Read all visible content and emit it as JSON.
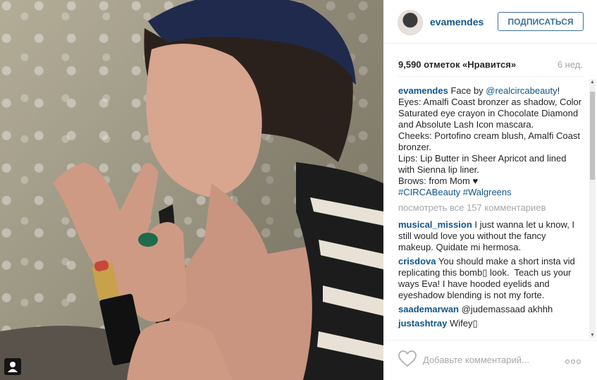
{
  "post": {
    "username": "evamendes",
    "follow_label": "ПОДПИСАТЬСЯ",
    "likes": "9,590 отметок «Нравится»",
    "age": "6 нед."
  },
  "caption": {
    "user": "evamendes",
    "lead": " Face by ",
    "mention": "@realcircabeauty",
    "body": "!\nEyes: Amalfi Coast bronzer as shadow, Color Saturated eye crayon in Chocolate Diamond and Absolute Lash Icon mascara.\nCheeks: Portofino cream blush, Amalfi Coast bronzer.\nLips: Lip Butter in Sheer Apricot and lined with Sienna lip liner.\nBrows: from Mom ♥\n",
    "hashtags": "#CIRCABeauty #Walgreens"
  },
  "view_all": "посмотреть все 157 комментариев",
  "comments": [
    {
      "user": "musical_mission",
      "text": " I just wanna let u know, I still would love you without the fancy makeup. Quidate mi hermosa."
    },
    {
      "user": "crisdova",
      "text": " You should make a short insta vid replicating this bomb▯ look.  Teach us your ways Eva! I have hooded eyelids and eyeshadow blending is not my forte."
    },
    {
      "user": "saademarwan",
      "text": " @judemassaad akhhh"
    },
    {
      "user": "justashtray",
      "text": " Wifey▯"
    }
  ],
  "comment_box": {
    "placeholder": "Добавьте комментарий..."
  },
  "icons": {
    "like": "heart-icon",
    "more": "more-options-icon",
    "tag": "user-tag-icon"
  },
  "colors": {
    "link": "#125688",
    "follow": "#3f729b",
    "muted": "#a5a7aa"
  }
}
